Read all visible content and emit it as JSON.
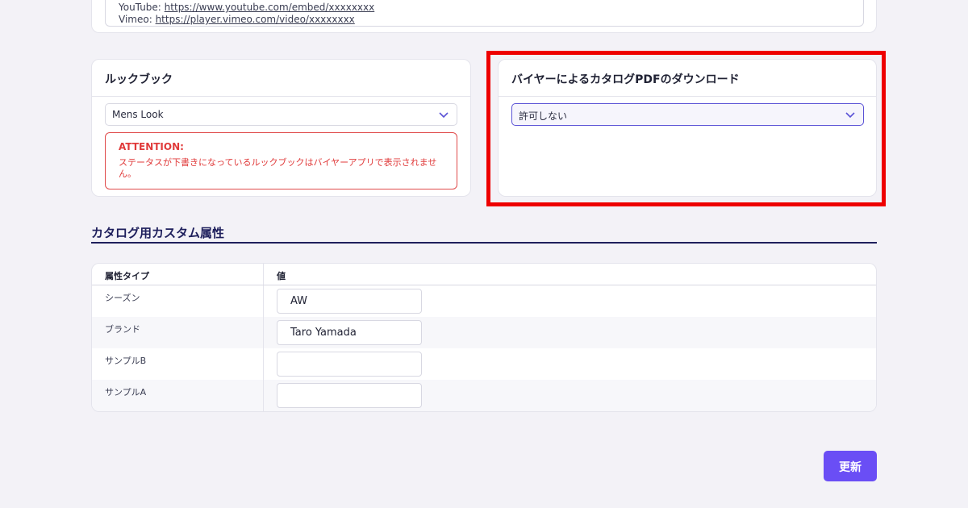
{
  "video_urls": {
    "youtube_label": "YouTube:",
    "youtube_url": "https://www.youtube.com/embed/xxxxxxxx",
    "vimeo_label": "Vimeo:",
    "vimeo_url": "https://player.vimeo.com/video/xxxxxxxx"
  },
  "lookbook": {
    "title": "ルックブック",
    "selected": "Mens Look",
    "attention_title": "ATTENTION:",
    "attention_text": "ステータスが下書きになっているルックブックはバイヤーアプリで表示されません。"
  },
  "pdf_download": {
    "title": "バイヤーによるカタログPDFのダウンロード",
    "selected": "許可しない"
  },
  "custom_attributes": {
    "section_title": "カタログ用カスタム属性",
    "col_type": "属性タイプ",
    "col_value": "値",
    "rows": [
      {
        "type": "シーズン",
        "value": "AW"
      },
      {
        "type": "ブランド",
        "value": "Taro Yamada"
      },
      {
        "type": "サンプルB",
        "value": ""
      },
      {
        "type": "サンプルA",
        "value": ""
      }
    ]
  },
  "actions": {
    "update_label": "更新"
  },
  "colors": {
    "accent": "#6a4ef5",
    "highlight": "#ee0000",
    "attention": "#e03a3a"
  }
}
